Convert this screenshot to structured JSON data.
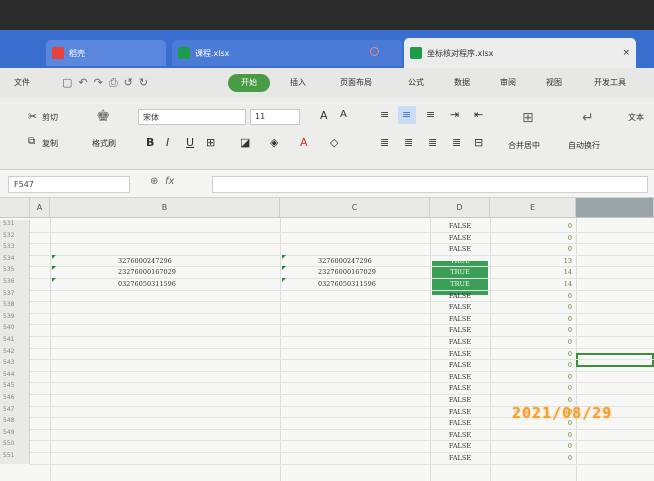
{
  "tabs": {
    "home_label": "稻壳",
    "file1_label": "课程.xlsx",
    "active_label": "坐标核对程序.xlsx",
    "close": "×",
    "add": "+"
  },
  "menu": {
    "file": "文件",
    "start": "开始",
    "insert": "插入",
    "page_layout": "页面布局",
    "formula": "公式",
    "data": "数据",
    "review": "审阅",
    "view": "视图",
    "dev_tools": "开发工具"
  },
  "ribbon": {
    "cut": "剪切",
    "copy": "复制",
    "format_painter": "格式刷",
    "font_name": "宋体",
    "font_size": "11",
    "merge_center": "合并居中",
    "wrap_text": "自动换行",
    "text_label": "文本"
  },
  "formula_bar": {
    "name_box": "F547",
    "fx": "fx"
  },
  "columns": [
    "A",
    "B",
    "C",
    "D",
    "E"
  ],
  "rows": [
    {
      "num": "531",
      "b": "",
      "c": "",
      "d": "FALSE",
      "e": "0"
    },
    {
      "num": "532",
      "b": "",
      "c": "",
      "d": "FALSE",
      "e": "0"
    },
    {
      "num": "533",
      "b": "",
      "c": "",
      "d": "FALSE",
      "e": "0"
    },
    {
      "num": "534",
      "b": "3276000247296",
      "c": "3276000247296",
      "d": "TRUE",
      "e": "13"
    },
    {
      "num": "535",
      "b": "23276000167029",
      "c": "23276000167029",
      "d": "TRUE",
      "e": "14"
    },
    {
      "num": "536",
      "b": "03276050311596",
      "c": "03276050311596",
      "d": "TRUE",
      "e": "14"
    },
    {
      "num": "537",
      "b": "",
      "c": "",
      "d": "FALSE",
      "e": "0"
    },
    {
      "num": "538",
      "b": "",
      "c": "",
      "d": "FALSE",
      "e": "0"
    },
    {
      "num": "539",
      "b": "",
      "c": "",
      "d": "FALSE",
      "e": "0"
    },
    {
      "num": "540",
      "b": "",
      "c": "",
      "d": "FALSE",
      "e": "0"
    },
    {
      "num": "541",
      "b": "",
      "c": "",
      "d": "FALSE",
      "e": "0"
    },
    {
      "num": "542",
      "b": "",
      "c": "",
      "d": "FALSE",
      "e": "0"
    },
    {
      "num": "543",
      "b": "",
      "c": "",
      "d": "FALSE",
      "e": "0"
    },
    {
      "num": "544",
      "b": "",
      "c": "",
      "d": "FALSE",
      "e": "0"
    },
    {
      "num": "545",
      "b": "",
      "c": "",
      "d": "FALSE",
      "e": "0"
    },
    {
      "num": "546",
      "b": "",
      "c": "",
      "d": "FALSE",
      "e": "0"
    },
    {
      "num": "547",
      "b": "",
      "c": "",
      "d": "FALSE",
      "e": "0"
    },
    {
      "num": "548",
      "b": "",
      "c": "",
      "d": "FALSE",
      "e": "0"
    },
    {
      "num": "549",
      "b": "",
      "c": "",
      "d": "FALSE",
      "e": "0"
    },
    {
      "num": "550",
      "b": "",
      "c": "",
      "d": "FALSE",
      "e": "0"
    },
    {
      "num": "551",
      "b": "",
      "c": "",
      "d": "FALSE",
      "e": "0"
    }
  ],
  "photo_stamp": "2021/08/29",
  "colors": {
    "tabbar": "#3a6fd0",
    "accent_green": "#4a9b48",
    "true_fill": "#3b9e56"
  }
}
